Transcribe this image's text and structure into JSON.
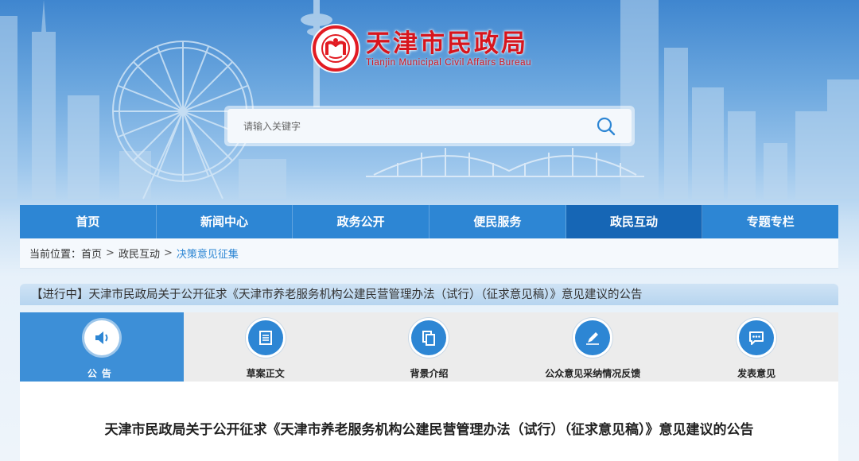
{
  "header": {
    "logo_cn": "天津市民政局",
    "logo_en": "Tianjin Municipal Civil Affairs Bureau",
    "emblem_icon": "civil-affairs-emblem-icon",
    "brand_color": "#d7151d"
  },
  "search": {
    "placeholder": "请输入关键字",
    "icon": "search-icon"
  },
  "nav": {
    "items": [
      {
        "label": "首页"
      },
      {
        "label": "新闻中心"
      },
      {
        "label": "政务公开"
      },
      {
        "label": "便民服务"
      },
      {
        "label": "政民互动"
      },
      {
        "label": "专题专栏"
      }
    ],
    "active_index": 4,
    "color": "#2d86d4",
    "active_color": "#1666b5"
  },
  "breadcrumb": {
    "prefix": "当前位置：",
    "items": [
      "首页",
      "政民互动",
      "决策意见征集"
    ],
    "separator": ">"
  },
  "notice": {
    "text": "【进行中】天津市民政局关于公开征求《天津市养老服务机构公建民营管理办法（试行）（征求意见稿）》意见建议的公告"
  },
  "tabs": {
    "items": [
      {
        "label": "公告",
        "icon": "speaker-icon"
      },
      {
        "label": "草案正文",
        "icon": "document-icon"
      },
      {
        "label": "背景介绍",
        "icon": "copy-icon"
      },
      {
        "label": "公众意见采纳情况反馈",
        "icon": "edit-pen-icon"
      },
      {
        "label": "发表意见",
        "icon": "chat-bubble-icon"
      }
    ],
    "active_index": 0
  },
  "content": {
    "title": "天津市民政局关于公开征求《天津市养老服务机构公建民营管理办法（试行）（征求意见稿）》意见建议的公告"
  }
}
